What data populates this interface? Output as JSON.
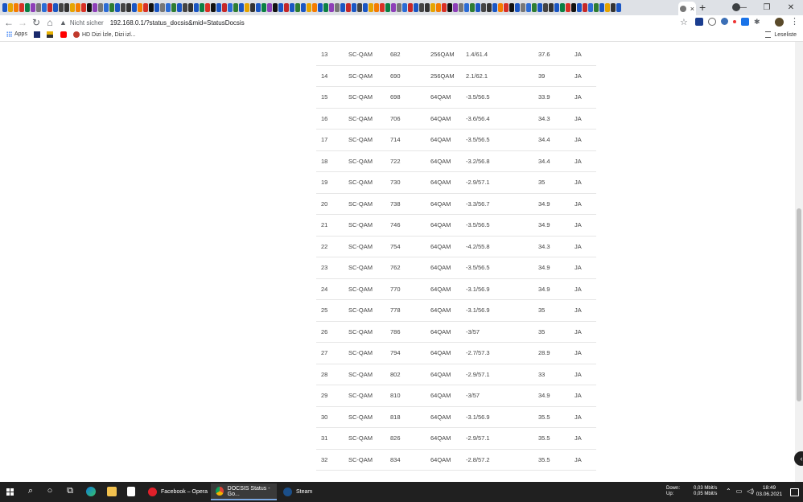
{
  "browser": {
    "url_warning": "Nicht sicher",
    "url": "192.168.0.1/?status_docsis&mid=StatusDocsis",
    "active_tab_close": "×",
    "new_tab": "+",
    "window_controls": [
      "—",
      "❐",
      "✕"
    ],
    "bookmarks": {
      "apps_label": "Apps",
      "item_hd": "HD Dizi İzle, Dizi izl...",
      "reading_list": "Leseliste"
    }
  },
  "channels": {
    "rows": [
      {
        "id": "13",
        "type": "SC-QAM",
        "freq": "682",
        "mod": "256QAM",
        "power": "1.4/61.4",
        "snr": "37.6",
        "locked": "JA"
      },
      {
        "id": "14",
        "type": "SC-QAM",
        "freq": "690",
        "mod": "256QAM",
        "power": "2.1/62.1",
        "snr": "39",
        "locked": "JA"
      },
      {
        "id": "15",
        "type": "SC-QAM",
        "freq": "698",
        "mod": "64QAM",
        "power": "-3.5/56.5",
        "snr": "33.9",
        "locked": "JA"
      },
      {
        "id": "16",
        "type": "SC-QAM",
        "freq": "706",
        "mod": "64QAM",
        "power": "-3.6/56.4",
        "snr": "34.3",
        "locked": "JA"
      },
      {
        "id": "17",
        "type": "SC-QAM",
        "freq": "714",
        "mod": "64QAM",
        "power": "-3.5/56.5",
        "snr": "34.4",
        "locked": "JA"
      },
      {
        "id": "18",
        "type": "SC-QAM",
        "freq": "722",
        "mod": "64QAM",
        "power": "-3.2/56.8",
        "snr": "34.4",
        "locked": "JA"
      },
      {
        "id": "19",
        "type": "SC-QAM",
        "freq": "730",
        "mod": "64QAM",
        "power": "-2.9/57.1",
        "snr": "35",
        "locked": "JA"
      },
      {
        "id": "20",
        "type": "SC-QAM",
        "freq": "738",
        "mod": "64QAM",
        "power": "-3.3/56.7",
        "snr": "34.9",
        "locked": "JA"
      },
      {
        "id": "21",
        "type": "SC-QAM",
        "freq": "746",
        "mod": "64QAM",
        "power": "-3.5/56.5",
        "snr": "34.9",
        "locked": "JA"
      },
      {
        "id": "22",
        "type": "SC-QAM",
        "freq": "754",
        "mod": "64QAM",
        "power": "-4.2/55.8",
        "snr": "34.3",
        "locked": "JA"
      },
      {
        "id": "23",
        "type": "SC-QAM",
        "freq": "762",
        "mod": "64QAM",
        "power": "-3.5/56.5",
        "snr": "34.9",
        "locked": "JA"
      },
      {
        "id": "24",
        "type": "SC-QAM",
        "freq": "770",
        "mod": "64QAM",
        "power": "-3.1/56.9",
        "snr": "34.9",
        "locked": "JA"
      },
      {
        "id": "25",
        "type": "SC-QAM",
        "freq": "778",
        "mod": "64QAM",
        "power": "-3.1/56.9",
        "snr": "35",
        "locked": "JA"
      },
      {
        "id": "26",
        "type": "SC-QAM",
        "freq": "786",
        "mod": "64QAM",
        "power": "-3/57",
        "snr": "35",
        "locked": "JA"
      },
      {
        "id": "27",
        "type": "SC-QAM",
        "freq": "794",
        "mod": "64QAM",
        "power": "-2.7/57.3",
        "snr": "28.9",
        "locked": "JA"
      },
      {
        "id": "28",
        "type": "SC-QAM",
        "freq": "802",
        "mod": "64QAM",
        "power": "-2.9/57.1",
        "snr": "33",
        "locked": "JA"
      },
      {
        "id": "29",
        "type": "SC-QAM",
        "freq": "810",
        "mod": "64QAM",
        "power": "-3/57",
        "snr": "34.9",
        "locked": "JA"
      },
      {
        "id": "30",
        "type": "SC-QAM",
        "freq": "818",
        "mod": "64QAM",
        "power": "-3.1/56.9",
        "snr": "35.5",
        "locked": "JA"
      },
      {
        "id": "31",
        "type": "SC-QAM",
        "freq": "826",
        "mod": "64QAM",
        "power": "-2.9/57.1",
        "snr": "35.5",
        "locked": "JA"
      },
      {
        "id": "32",
        "type": "SC-QAM",
        "freq": "834",
        "mod": "64QAM",
        "power": "-2.8/57.2",
        "snr": "35.5",
        "locked": "JA"
      }
    ]
  },
  "taskbar": {
    "tasks": [
      {
        "label": "Facebook – Opera",
        "icon_color": "#e0202a"
      },
      {
        "label": "DOCSIS Status - Go...",
        "icon_color": "#4caf50"
      },
      {
        "label": "Steam",
        "icon_color": "#1b4f8a"
      }
    ],
    "net_down_label": "Down:",
    "net_down_value": "0,03 Mbit/s",
    "net_up_label": "Up:",
    "net_up_value": "0,05 Mbit/s",
    "time": "18:49",
    "date": "03.06.2021"
  },
  "colors": {
    "accent": "#4285f4",
    "row_border": "#e6e6e6",
    "taskbar_bg": "#202020"
  }
}
